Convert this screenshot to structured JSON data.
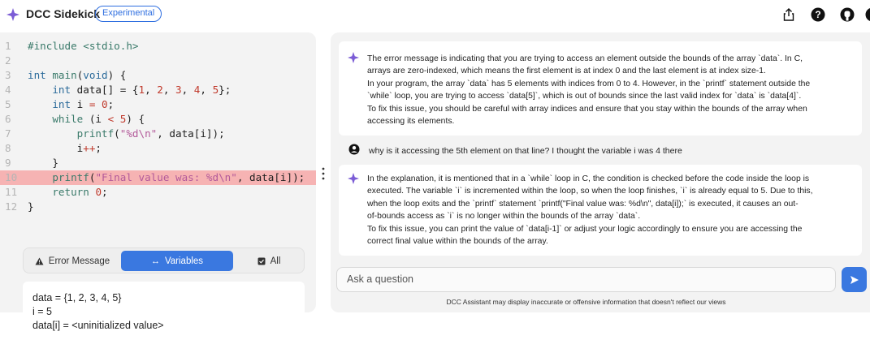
{
  "header": {
    "title": "DCC Sidekick",
    "badge": "Experimental",
    "icons": [
      "share-icon",
      "help-icon",
      "github-icon",
      "circle-icon"
    ]
  },
  "editor": {
    "line_numbers": [
      "1",
      "2",
      "3",
      "4",
      "5",
      "6",
      "7",
      "8",
      "9",
      "10",
      "11",
      "12"
    ],
    "highlighted_line": 10,
    "lines": [
      [
        [
          "tk-cm",
          "#include"
        ],
        [
          "tk-plain",
          " "
        ],
        [
          "tk-cm",
          "<stdio.h>"
        ]
      ],
      [],
      [
        [
          "tk-kw2",
          "int"
        ],
        [
          "tk-plain",
          " "
        ],
        [
          "tk-fn",
          "main"
        ],
        [
          "tk-plain",
          "("
        ],
        [
          "tk-kw2",
          "void"
        ],
        [
          "tk-plain",
          ") {"
        ]
      ],
      [
        [
          "tk-plain",
          "    "
        ],
        [
          "tk-kw2",
          "int"
        ],
        [
          "tk-plain",
          " data[] = {"
        ],
        [
          "tk-num",
          "1"
        ],
        [
          "tk-plain",
          ", "
        ],
        [
          "tk-num",
          "2"
        ],
        [
          "tk-plain",
          ", "
        ],
        [
          "tk-num",
          "3"
        ],
        [
          "tk-plain",
          ", "
        ],
        [
          "tk-num",
          "4"
        ],
        [
          "tk-plain",
          ", "
        ],
        [
          "tk-num",
          "5"
        ],
        [
          "tk-plain",
          "};"
        ]
      ],
      [
        [
          "tk-plain",
          "    "
        ],
        [
          "tk-kw2",
          "int"
        ],
        [
          "tk-plain",
          " i "
        ],
        [
          "tk-op",
          "="
        ],
        [
          "tk-plain",
          " "
        ],
        [
          "tk-num",
          "0"
        ],
        [
          "tk-plain",
          ";"
        ]
      ],
      [
        [
          "tk-plain",
          "    "
        ],
        [
          "tk-kw",
          "while"
        ],
        [
          "tk-plain",
          " (i "
        ],
        [
          "tk-op",
          "<"
        ],
        [
          "tk-plain",
          " "
        ],
        [
          "tk-num",
          "5"
        ],
        [
          "tk-plain",
          ") {"
        ]
      ],
      [
        [
          "tk-plain",
          "        "
        ],
        [
          "tk-fn",
          "printf"
        ],
        [
          "tk-plain",
          "("
        ],
        [
          "tk-str",
          "\"%d\\n\""
        ],
        [
          "tk-plain",
          ", data[i]);"
        ]
      ],
      [
        [
          "tk-plain",
          "        i"
        ],
        [
          "tk-op",
          "++"
        ],
        [
          "tk-plain",
          ";"
        ]
      ],
      [
        [
          "tk-plain",
          "    }"
        ]
      ],
      [
        [
          "tk-plain",
          "    "
        ],
        [
          "tk-fn",
          "printf"
        ],
        [
          "tk-plain",
          "("
        ],
        [
          "tk-str",
          "\"Final value was: %d\\n\""
        ],
        [
          "tk-plain",
          ", data[i]);"
        ]
      ],
      [
        [
          "tk-plain",
          "    "
        ],
        [
          "tk-kw",
          "return"
        ],
        [
          "tk-plain",
          " "
        ],
        [
          "tk-num",
          "0"
        ],
        [
          "tk-plain",
          ";"
        ]
      ],
      [
        [
          "tk-plain",
          "}"
        ]
      ]
    ]
  },
  "tabs": {
    "error": "Error Message",
    "variables": "Variables",
    "all": "All",
    "active": "variables"
  },
  "variables": {
    "lines": [
      "data = {1, 2, 3, 4, 5}",
      "i = 5",
      "data[i] = <uninitialized value>"
    ]
  },
  "chat": {
    "assistant_1": [
      "The error message is indicating that you are trying to access an element outside the bounds of the array `data`. In C,",
      "arrays are zero-indexed, which means the first element is at index 0 and the last element is at index size-1.",
      "In your program, the array `data` has 5 elements with indices from 0 to 4. However, in the `printf` statement outside the",
      "`while` loop, you are trying to access `data[5]`, which is out of bounds since the last valid index for `data` is `data[4]`.",
      "To fix this issue, you should be careful with array indices and ensure that you stay within the bounds of the array when",
      "accessing its elements."
    ],
    "user_question": "why is it accessing the 5th element on that line? I thought the variable i was 4 there",
    "assistant_2": [
      "In the explanation, it is mentioned that in a `while` loop in C, the condition is checked before the code inside the loop is",
      "executed. The variable `i` is incremented within the loop, so when the loop finishes, `i` is already equal to 5. Due to this,",
      "when the loop exits and the `printf` statement `printf(\"Final value was: %d\\n\", data[i]);` is executed, it causes an out-",
      "of-bounds access as `i` is no longer within the bounds of the array `data`.",
      "To fix this issue, you can print the value of `data[i-1]` or adjust your logic accordingly to ensure you are accessing the",
      "correct final value within the bounds of the array."
    ]
  },
  "composer": {
    "placeholder": "Ask a question",
    "disclaimer": "DCC Assistant may display inaccurate or offensive information that doesn't reflect our views"
  },
  "colors": {
    "accent": "#3a78e0",
    "highlight": "#f6b3b3",
    "logo": "#7b5cd6"
  }
}
